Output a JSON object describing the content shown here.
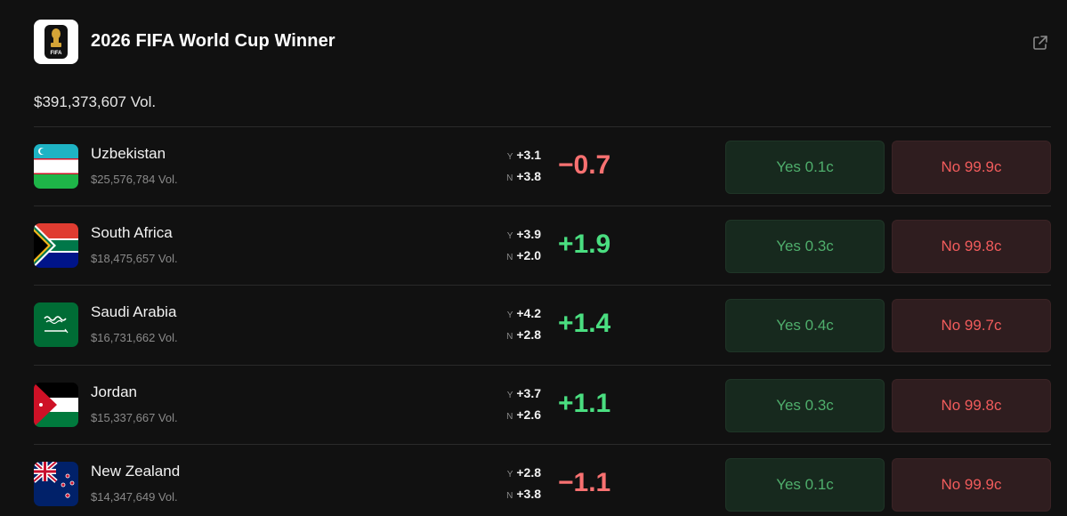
{
  "market": {
    "title": "2026 FIFA World Cup Winner",
    "volume": "$391,373,607 Vol.",
    "logo_icon": "world-cup-trophy-icon",
    "logo_text": "FIFA"
  },
  "colors": {
    "positive": "#4ade80",
    "negative": "#f87171",
    "yes_bg": "#17291e",
    "no_bg": "#2f1d1f"
  },
  "rows": [
    {
      "name": "Uzbekistan",
      "volume": "$25,576,784 Vol.",
      "y_label": "Y",
      "y_change": "+3.1",
      "n_label": "N",
      "n_change": "+3.8",
      "delta": "−0.7",
      "delta_sign": "negative",
      "yes_label": "Yes 0.1c",
      "no_label": "No 99.9c",
      "flag_icon": "uzbekistan-flag-icon"
    },
    {
      "name": "South Africa",
      "volume": "$18,475,657 Vol.",
      "y_label": "Y",
      "y_change": "+3.9",
      "n_label": "N",
      "n_change": "+2.0",
      "delta": "+1.9",
      "delta_sign": "positive",
      "yes_label": "Yes 0.3c",
      "no_label": "No 99.8c",
      "flag_icon": "south-africa-flag-icon"
    },
    {
      "name": "Saudi Arabia",
      "volume": "$16,731,662 Vol.",
      "y_label": "Y",
      "y_change": "+4.2",
      "n_label": "N",
      "n_change": "+2.8",
      "delta": "+1.4",
      "delta_sign": "positive",
      "yes_label": "Yes 0.4c",
      "no_label": "No 99.7c",
      "flag_icon": "saudi-arabia-flag-icon"
    },
    {
      "name": "Jordan",
      "volume": "$15,337,667 Vol.",
      "y_label": "Y",
      "y_change": "+3.7",
      "n_label": "N",
      "n_change": "+2.6",
      "delta": "+1.1",
      "delta_sign": "positive",
      "yes_label": "Yes 0.3c",
      "no_label": "No 99.8c",
      "flag_icon": "jordan-flag-icon"
    },
    {
      "name": "New Zealand",
      "volume": "$14,347,649 Vol.",
      "y_label": "Y",
      "y_change": "+2.8",
      "n_label": "N",
      "n_change": "+3.8",
      "delta": "−1.1",
      "delta_sign": "negative",
      "yes_label": "Yes 0.1c",
      "no_label": "No 99.9c",
      "flag_icon": "new-zealand-flag-icon"
    }
  ]
}
